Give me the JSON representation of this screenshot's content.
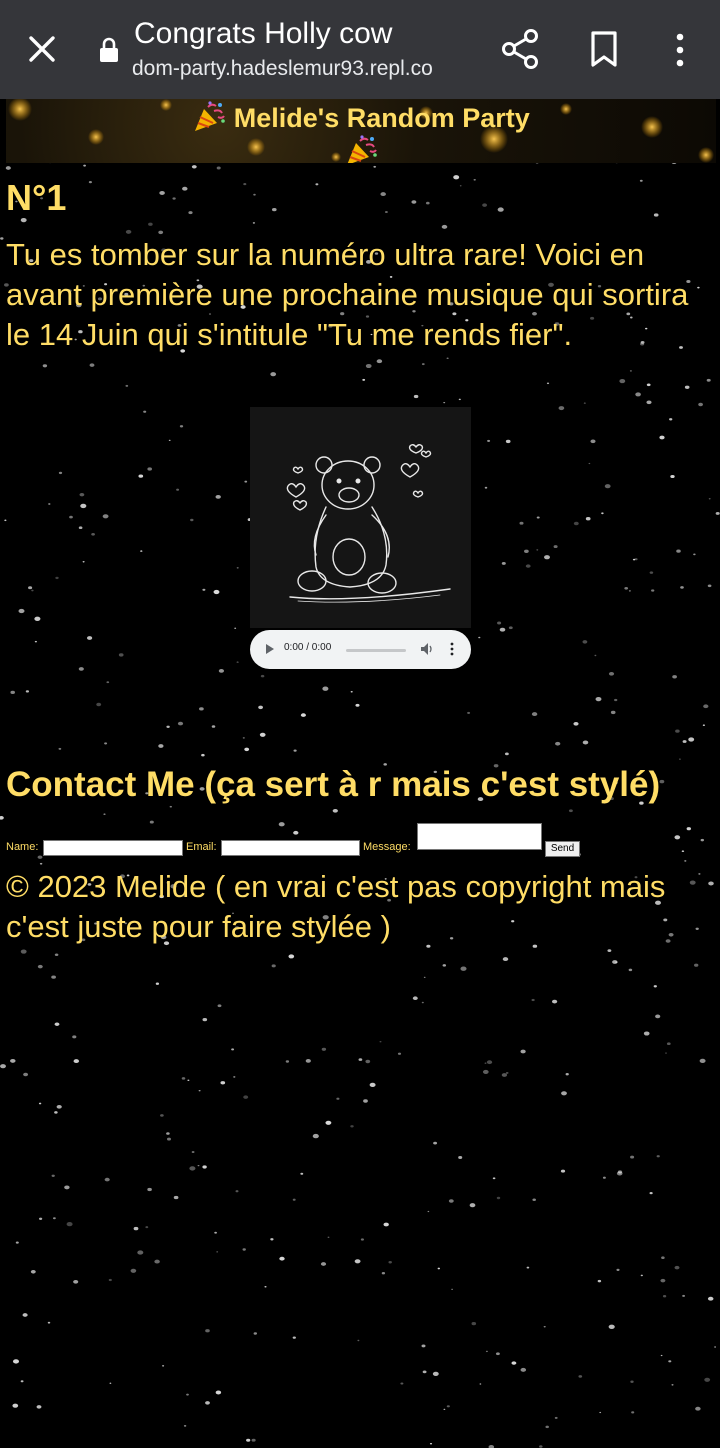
{
  "toolbar": {
    "title": "Congrats Holly cow",
    "url": "dom-party.hadeslemur93.repl.co",
    "icons": [
      "close-icon",
      "lock-icon",
      "share-icon",
      "bookmark-icon",
      "more-vert-icon"
    ]
  },
  "banner": {
    "title": "Melide's Random Party",
    "icon": "party-popper-icon"
  },
  "main": {
    "heading": "N°1",
    "intro": "Tu es tomber sur la numéro ultra rare! Voici en avant première une prochaine musique qui sortira le 14 Juin qui s'intitule \"Tu me rends fier\".",
    "cover_icon": "teddy-bear-sketch",
    "audio": {
      "time": "0:00 / 0:00",
      "progress": 0
    }
  },
  "contact": {
    "title": "Contact Me (ça sert à r mais c'est stylé)",
    "name_label": "Name:",
    "email_label": "Email:",
    "message_label": "Message:",
    "name_value": "",
    "email_value": "",
    "message_value": "",
    "send_label": "Send"
  },
  "footer": {
    "text": "© 2023 Melide ( en vrai c'est pas copyright mais c'est juste pour faire stylée )"
  },
  "colors": {
    "accent_text": "#ffdd66",
    "toolbar_bg": "#35363a",
    "page_bg": "#000000"
  }
}
